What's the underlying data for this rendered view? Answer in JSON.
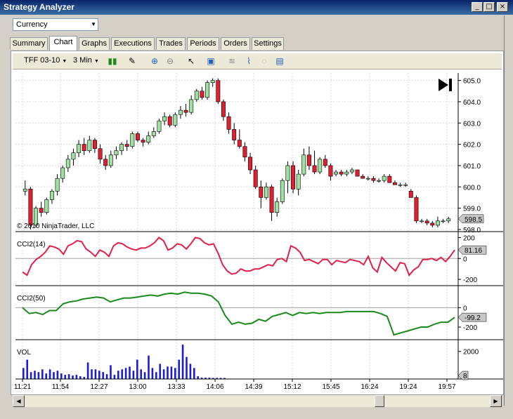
{
  "window": {
    "title": "Strategy Analyzer",
    "min_glyph": "_",
    "max_glyph": "□",
    "close_glyph": "×"
  },
  "currency": {
    "value": "Currency"
  },
  "tabs": [
    "Summary",
    "Chart",
    "Graphs",
    "Executions",
    "Trades",
    "Periods",
    "Orders",
    "Settings"
  ],
  "active_tab": "Chart",
  "toolbar": {
    "instrument": "TFF 03-10",
    "interval": "3 Min"
  },
  "chart": {
    "copyright": "© 2010 NinjaTrader, LLC",
    "price_ticks": [
      "605.0",
      "604.0",
      "603.0",
      "602.0",
      "601.0",
      "600.0",
      "599.0",
      "598.0"
    ],
    "last_price": "598.5",
    "time_labels": [
      "11:21",
      "11:54",
      "12:27",
      "13:00",
      "13:33",
      "14:06",
      "14:39",
      "15:12",
      "15:45",
      "16:24",
      "19:24",
      "19:57"
    ],
    "cci14": {
      "label": "CCI2(14)",
      "ticks": [
        "200",
        "0",
        "-200"
      ],
      "value": "81.16"
    },
    "cci50": {
      "label": "CCI2(50)",
      "ticks": [
        "0",
        "-200"
      ],
      "value": "-99.2"
    },
    "vol": {
      "label": "VOL",
      "ticks": [
        "2000"
      ],
      "value": "8"
    }
  },
  "colors": {
    "up": "#a0e0a0",
    "down": "#e02030",
    "cci14": "#e0204a",
    "cci50": "#1a8a1a",
    "vol": "#1c1cd8"
  },
  "chart_data": {
    "type": "candlestick",
    "price_ylim": [
      598.0,
      605.0
    ],
    "candles": [
      [
        599.8,
        600.3,
        599.6,
        599.9
      ],
      [
        599.9,
        600.0,
        598.0,
        598.2
      ],
      [
        598.2,
        599.1,
        598.1,
        599.0
      ],
      [
        599.0,
        599.3,
        598.6,
        598.8
      ],
      [
        598.8,
        599.5,
        598.7,
        599.4
      ],
      [
        599.4,
        599.9,
        599.2,
        599.8
      ],
      [
        599.8,
        600.6,
        599.6,
        600.4
      ],
      [
        600.4,
        601.0,
        600.2,
        600.9
      ],
      [
        600.9,
        601.5,
        600.7,
        601.3
      ],
      [
        601.3,
        601.8,
        601.0,
        601.6
      ],
      [
        601.6,
        602.2,
        601.4,
        602.0
      ],
      [
        602.0,
        602.3,
        601.5,
        601.7
      ],
      [
        601.7,
        602.4,
        601.6,
        602.2
      ],
      [
        602.2,
        602.3,
        601.6,
        601.8
      ],
      [
        601.8,
        602.0,
        601.1,
        601.3
      ],
      [
        601.3,
        601.5,
        600.8,
        601.0
      ],
      [
        601.0,
        601.7,
        600.9,
        601.5
      ],
      [
        601.5,
        601.9,
        601.3,
        601.7
      ],
      [
        601.7,
        602.1,
        601.5,
        602.0
      ],
      [
        602.0,
        602.2,
        601.7,
        601.9
      ],
      [
        601.9,
        602.6,
        601.8,
        602.5
      ],
      [
        602.5,
        602.6,
        602.1,
        602.2
      ],
      [
        602.2,
        602.3,
        601.9,
        602.1
      ],
      [
        602.1,
        602.6,
        602.0,
        602.4
      ],
      [
        602.4,
        602.8,
        602.3,
        602.6
      ],
      [
        602.6,
        603.2,
        602.5,
        603.1
      ],
      [
        603.1,
        603.5,
        602.9,
        603.3
      ],
      [
        603.3,
        603.4,
        602.8,
        602.9
      ],
      [
        602.9,
        603.5,
        602.8,
        603.4
      ],
      [
        603.4,
        603.8,
        603.2,
        603.6
      ],
      [
        603.6,
        603.9,
        603.3,
        603.5
      ],
      [
        603.5,
        604.3,
        603.4,
        604.1
      ],
      [
        604.1,
        604.6,
        604.0,
        604.5
      ],
      [
        604.5,
        604.7,
        604.1,
        604.2
      ],
      [
        604.2,
        605.0,
        604.1,
        604.9
      ],
      [
        604.9,
        605.1,
        604.7,
        605.0
      ],
      [
        605.0,
        605.1,
        603.9,
        604.0
      ],
      [
        604.0,
        604.1,
        603.1,
        603.3
      ],
      [
        603.3,
        603.5,
        602.5,
        602.7
      ],
      [
        602.7,
        603.0,
        602.0,
        602.2
      ],
      [
        602.2,
        602.7,
        601.8,
        601.9
      ],
      [
        601.9,
        602.1,
        601.2,
        601.4
      ],
      [
        601.4,
        601.6,
        600.6,
        600.8
      ],
      [
        600.8,
        601.0,
        599.9,
        600.0
      ],
      [
        600.0,
        600.3,
        599.0,
        599.5
      ],
      [
        599.5,
        600.2,
        599.4,
        600.0
      ],
      [
        600.0,
        600.1,
        598.4,
        598.8
      ],
      [
        598.8,
        599.5,
        598.6,
        599.3
      ],
      [
        599.3,
        600.4,
        599.2,
        600.3
      ],
      [
        600.3,
        601.2,
        599.7,
        601.0
      ],
      [
        601.0,
        601.2,
        599.7,
        599.9
      ],
      [
        599.9,
        600.8,
        599.6,
        600.6
      ],
      [
        600.6,
        601.8,
        600.5,
        601.5
      ],
      [
        601.5,
        601.9,
        600.8,
        601.0
      ],
      [
        601.0,
        601.7,
        600.6,
        600.7
      ],
      [
        600.7,
        601.4,
        600.6,
        601.3
      ],
      [
        601.3,
        601.5,
        600.9,
        601.0
      ],
      [
        601.0,
        601.1,
        600.3,
        600.5
      ],
      [
        600.6,
        600.8,
        600.5,
        600.7
      ],
      [
        600.7,
        600.8,
        600.5,
        600.6
      ],
      [
        600.6,
        600.8,
        600.5,
        600.7
      ],
      [
        600.7,
        600.9,
        600.6,
        600.8
      ],
      [
        600.8,
        600.8,
        600.5,
        600.5
      ],
      [
        600.5,
        600.6,
        600.4,
        600.4
      ],
      [
        600.4,
        600.5,
        600.3,
        600.4
      ],
      [
        600.4,
        600.5,
        600.2,
        600.3
      ],
      [
        600.3,
        600.4,
        600.2,
        600.3
      ],
      [
        600.3,
        600.6,
        600.2,
        600.5
      ],
      [
        600.5,
        600.6,
        600.2,
        600.2
      ],
      [
        600.2,
        600.3,
        600.1,
        600.1
      ],
      [
        600.1,
        600.2,
        600.0,
        600.1
      ],
      [
        600.1,
        600.2,
        600.0,
        600.1
      ],
      [
        599.8,
        599.9,
        599.5,
        599.5
      ],
      [
        599.5,
        599.6,
        598.3,
        598.4
      ],
      [
        598.4,
        598.5,
        598.3,
        598.4
      ],
      [
        598.4,
        598.5,
        598.2,
        598.3
      ],
      [
        598.3,
        598.4,
        598.1,
        598.2
      ],
      [
        598.2,
        598.6,
        598.1,
        598.4
      ],
      [
        598.4,
        598.5,
        598.3,
        598.4
      ],
      [
        598.4,
        598.6,
        598.3,
        598.5
      ]
    ],
    "cci14": [
      -130,
      -160,
      -60,
      -10,
      20,
      60,
      120,
      110,
      90,
      40,
      120,
      140,
      170,
      160,
      90,
      60,
      20,
      80,
      60,
      20,
      120,
      150,
      140,
      110,
      90,
      80,
      100,
      100,
      120,
      150,
      200,
      170,
      80,
      100,
      140,
      130,
      90,
      140,
      200,
      190,
      150,
      130,
      140,
      50,
      -60,
      -120,
      -150,
      -140,
      -100,
      -120,
      -120,
      -100,
      -100,
      -80,
      -60,
      -70,
      -10,
      0,
      -30,
      120,
      100,
      60,
      -20,
      -10,
      -30,
      -50,
      -10,
      -10,
      -60,
      -20,
      -30,
      -40,
      -10,
      -20,
      -30,
      -60,
      20,
      -90,
      -130,
      10,
      -40,
      -80,
      -120,
      -40,
      -50,
      -160,
      -110,
      -80,
      -10,
      -10,
      0,
      -20,
      10,
      -30,
      20,
      81
    ],
    "cci50": [
      0,
      -60,
      -50,
      -70,
      -30,
      -30,
      40,
      60,
      70,
      90,
      100,
      110,
      100,
      60,
      80,
      100,
      100,
      110,
      120,
      130,
      120,
      140,
      150,
      140,
      160,
      150,
      150,
      140,
      120,
      60,
      -80,
      -170,
      -150,
      -170,
      -160,
      -120,
      -140,
      -90,
      -70,
      -50,
      -80,
      -50,
      -60,
      -50,
      -60,
      -50,
      -50,
      -50,
      -40,
      -40,
      -40,
      -40,
      -40,
      -60,
      -90,
      -280,
      -260,
      -240,
      -220,
      -200,
      -200,
      -170,
      -150,
      -150,
      -100
    ],
    "volume": [
      800,
      1400,
      500,
      600,
      500,
      700,
      400,
      700,
      500,
      600,
      400,
      300,
      350,
      250,
      300,
      200,
      150,
      1200,
      700,
      700,
      600,
      500,
      350,
      1000,
      300,
      600,
      700,
      800,
      900,
      600,
      1400,
      700,
      500,
      1700,
      800,
      500,
      1100,
      700,
      900,
      900,
      800,
      1400,
      2500,
      1600,
      1100,
      800,
      200,
      100,
      100,
      100,
      80,
      80,
      80,
      80
    ],
    "xlabel": "",
    "ylabel": ""
  }
}
